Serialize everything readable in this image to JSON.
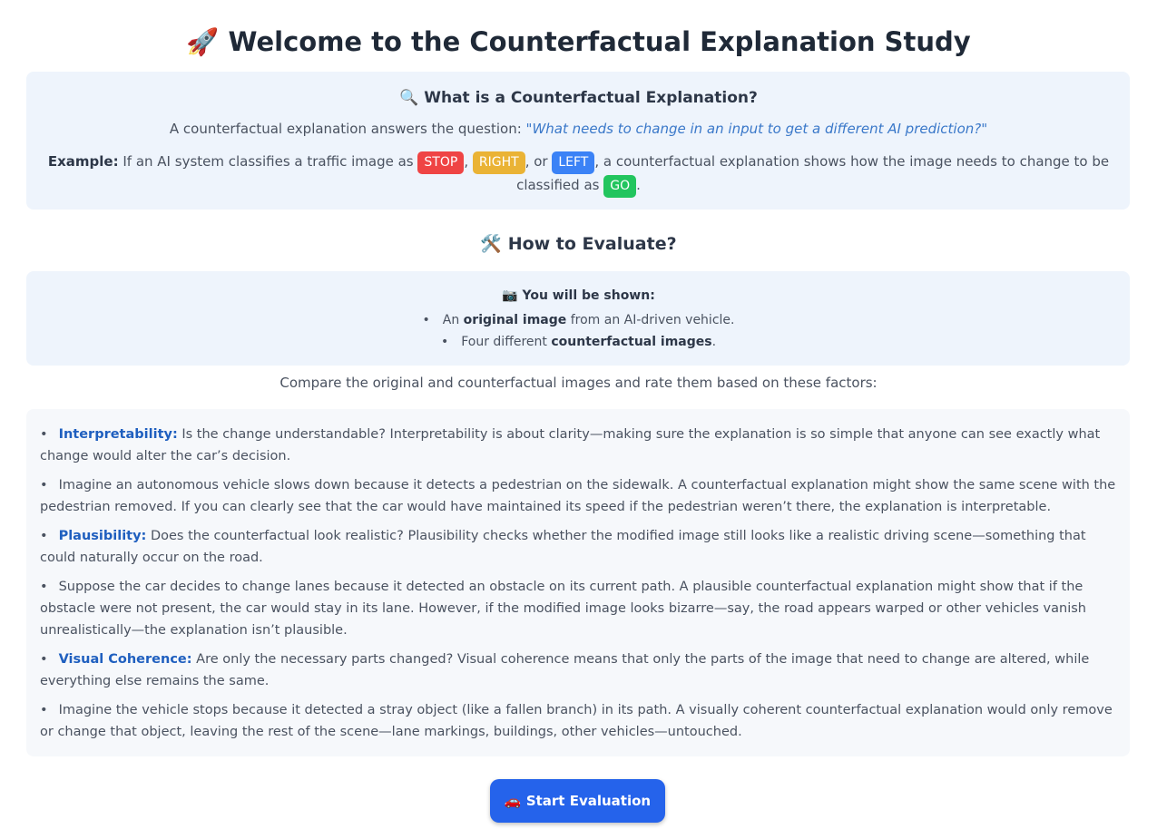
{
  "header": {
    "icon": "rocket-icon",
    "title_emoji": "🚀",
    "title": "Welcome to the Counterfactual Explanation Study"
  },
  "counterfactual": {
    "title_emoji": "🔍",
    "title": "What is a Counterfactual Explanation?",
    "intro": "A counterfactual explanation answers the question:",
    "quote": "\"What needs to change in an input to get a different AI prediction?\"",
    "example_label": "Example:",
    "example_pre": "If an AI system classifies a traffic image as",
    "tags": {
      "stop": "STOP",
      "right": "RIGHT",
      "left": "LEFT",
      "go": "GO"
    },
    "sep1": ",",
    "sep2": ", or",
    "example_post": ", a counterfactual explanation shows how the image needs to change to be classified as",
    "end": "."
  },
  "how": {
    "title_emoji": "🛠️",
    "title": "How to Evaluate?"
  },
  "shown": {
    "title_emoji": "📷",
    "title": "You will be shown:",
    "item1_pre": "An",
    "item1_bold": "original image",
    "item1_post": "from an AI-driven vehicle.",
    "item2_pre": "Four different",
    "item2_bold": "counterfactual images",
    "item2_post": "."
  },
  "compare_text": "Compare the original and counterfactual images and rate them based on these factors:",
  "factors": {
    "interp_term": "Interpretability:",
    "interp_text": "Is the change understandable? Interpretability is about clarity—making sure the explanation is so simple that anyone can see exactly what change would alter the car’s decision.",
    "interp_example": "Imagine an autonomous vehicle slows down because it detects a pedestrian on the sidewalk. A counterfactual explanation might show the same scene with the pedestrian removed. If you can clearly see that the car would have maintained its speed if the pedestrian weren’t there, the explanation is interpretable.",
    "plaus_term": "Plausibility:",
    "plaus_text": "Does the counterfactual look realistic? Plausibility checks whether the modified image still looks like a realistic driving scene—something that could naturally occur on the road.",
    "plaus_example": "Suppose the car decides to change lanes because it detected an obstacle on its current path. A plausible counterfactual explanation might show that if the obstacle were not present, the car would stay in its lane. However, if the modified image looks bizarre—say, the road appears warped or other vehicles vanish unrealistically—the explanation isn’t plausible.",
    "visual_term": "Visual Coherence:",
    "visual_text": "Are only the necessary parts changed? Visual coherence means that only the parts of the image that need to change are altered, while everything else remains the same.",
    "visual_example": "Imagine the vehicle stops because it detected a stray object (like a fallen branch) in its path. A visually coherent counterfactual explanation would only remove or change that object, leaving the rest of the scene—lane markings, buildings, other vehicles—untouched."
  },
  "start_button": {
    "icon": "car-icon",
    "emoji": "🚗",
    "label": "Start Evaluation"
  }
}
